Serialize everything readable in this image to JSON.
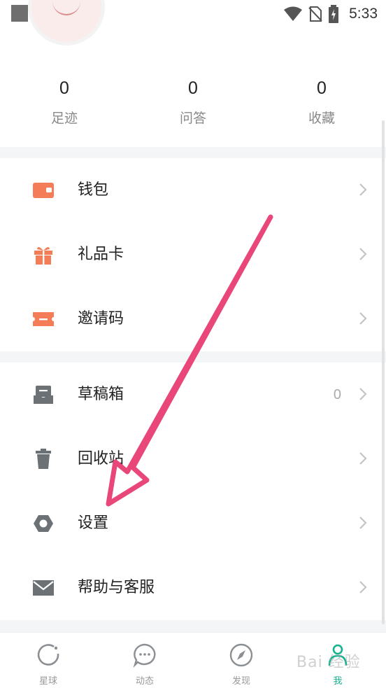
{
  "status_bar": {
    "time": "5:33"
  },
  "stats": [
    {
      "count": "0",
      "label": "足迹"
    },
    {
      "count": "0",
      "label": "问答"
    },
    {
      "count": "0",
      "label": "收藏"
    }
  ],
  "menu": {
    "wallet": {
      "label": "钱包",
      "icon": "wallet-icon"
    },
    "gift_card": {
      "label": "礼品卡",
      "icon": "gift-icon"
    },
    "invite_code": {
      "label": "邀请码",
      "icon": "ticket-icon"
    },
    "drafts": {
      "label": "草稿箱",
      "count": "0",
      "icon": "drafts-icon"
    },
    "recycle_bin": {
      "label": "回收站",
      "icon": "trash-icon"
    },
    "settings": {
      "label": "设置",
      "icon": "gear-icon"
    },
    "help": {
      "label": "帮助与客服",
      "icon": "mail-icon"
    }
  },
  "bottom_nav": [
    {
      "label": "星球",
      "icon": "planet-icon"
    },
    {
      "label": "动态",
      "icon": "chat-bubble-icon"
    },
    {
      "label": "发现",
      "icon": "compass-icon"
    },
    {
      "label": "我",
      "icon": "user-icon",
      "active": true
    }
  ],
  "colors": {
    "accent_orange": "#f47c56",
    "icon_gray": "#6b7175",
    "active_green": "#15b28f",
    "arrow_pink": "#e9467a"
  },
  "watermark": "Bai 经验"
}
